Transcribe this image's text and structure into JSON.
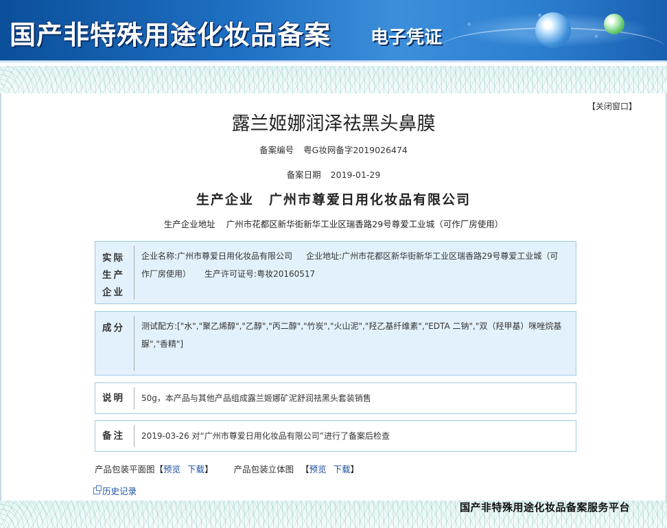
{
  "header": {
    "title": "国产非特殊用途化妆品备案",
    "subtitle": "电子凭证"
  },
  "close_window": "【关闭窗口】",
  "product": {
    "name": "露兰姬娜润泽祛黑头鼻膜",
    "reg_label": "备案编号",
    "reg_number": "粤G妆网备字2019026474",
    "date_label": "备案日期",
    "date_value": "2019-01-29",
    "producer_label": "生产企业",
    "producer_name": "广州市尊爱日用化妆品有限公司",
    "address_label": "生产企业地址",
    "address_value": "广州市花都区新华街新华工业区瑞香路29号尊爱工业城（可作厂房使用）"
  },
  "actual_producer": {
    "label": "实际生产企业",
    "company_label": "企业名称:",
    "company_value": "广州市尊爱日用化妆品有限公司",
    "address_label": "企业地址:",
    "address_value": "广州市花都区新华街新华工业区瑞香路29号尊爱工业城（可作厂房使用）",
    "license_label": "生产许可证号:",
    "license_value": "粤妆20160517"
  },
  "ingredients": {
    "label": "成分",
    "text": "测试配方:[\"水\",\"聚乙烯醇\",\"乙醇\",\"丙二醇\",\"竹炭\",\"火山泥\",\"羟乙基纤维素\",\"EDTA 二钠\",\"双（羟甲基）咪唑烷基脲\",\"香精\"]"
  },
  "description": {
    "label": "说明",
    "text": "50g，本产品与其他产品组成露兰姬娜矿泥舒润祛黑头套装销售"
  },
  "remarks": {
    "label": "备注",
    "text": "2019-03-26 对“广州市尊爱日用化妆品有限公司”进行了备案后检查"
  },
  "package": {
    "flat_label": "产品包装平面图",
    "solid_label": "产品包装立体图",
    "preview": "预览",
    "download": "下载",
    "bracket_open": "【",
    "bracket_close": "】"
  },
  "history": "历史记录",
  "footer_brand": "国产非特殊用途化妆品备案服务平台"
}
